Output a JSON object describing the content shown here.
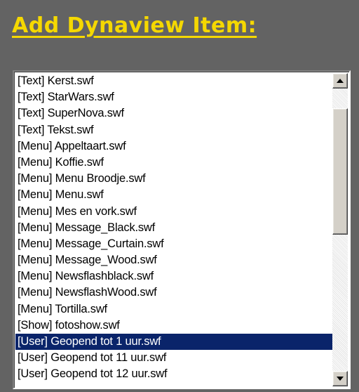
{
  "panel": {
    "title": "Add Dynaview Item:"
  },
  "listbox": {
    "items": [
      {
        "label": "[Text] Kerst.swf",
        "selected": false
      },
      {
        "label": "[Text] StarWars.swf",
        "selected": false
      },
      {
        "label": "[Text] SuperNova.swf",
        "selected": false
      },
      {
        "label": "[Text] Tekst.swf",
        "selected": false
      },
      {
        "label": "[Menu] Appeltaart.swf",
        "selected": false
      },
      {
        "label": "[Menu] Koffie.swf",
        "selected": false
      },
      {
        "label": "[Menu] Menu Broodje.swf",
        "selected": false
      },
      {
        "label": "[Menu] Menu.swf",
        "selected": false
      },
      {
        "label": "[Menu] Mes en vork.swf",
        "selected": false
      },
      {
        "label": "[Menu] Message_Black.swf",
        "selected": false
      },
      {
        "label": "[Menu] Message_Curtain.swf",
        "selected": false
      },
      {
        "label": "[Menu] Message_Wood.swf",
        "selected": false
      },
      {
        "label": "[Menu] Newsflashblack.swf",
        "selected": false
      },
      {
        "label": "[Menu] NewsflashWood.swf",
        "selected": false
      },
      {
        "label": "[Menu] Tortilla.swf",
        "selected": false
      },
      {
        "label": "[Show] fotoshow.swf",
        "selected": false
      },
      {
        "label": "[User] Geopend tot 1 uur.swf",
        "selected": true
      },
      {
        "label": "[User] Geopend tot 11 uur.swf",
        "selected": false
      },
      {
        "label": "[User] Geopend tot 12 uur.swf",
        "selected": false
      }
    ],
    "scrollbar": {
      "up_icon": "arrow-up-icon",
      "down_icon": "arrow-down-icon"
    }
  },
  "colors": {
    "background": "#636363",
    "title": "#f5d800",
    "selection": "#0a246a"
  }
}
